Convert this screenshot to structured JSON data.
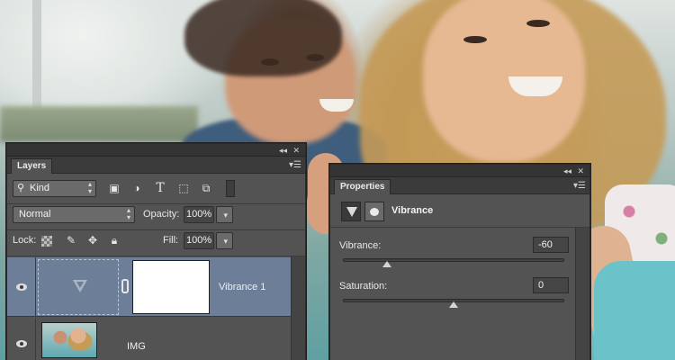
{
  "layers_panel": {
    "tab_label": "Layers",
    "filter": {
      "label": "Kind"
    },
    "blend_mode": "Normal",
    "opacity_label": "Opacity:",
    "opacity_value": "100%",
    "lock_label": "Lock:",
    "fill_label": "Fill:",
    "fill_value": "100%",
    "layers": [
      {
        "name": "Vibrance 1",
        "selected": true,
        "visible": true
      },
      {
        "name": "IMG",
        "selected": false,
        "visible": true
      }
    ]
  },
  "properties_panel": {
    "tab_label": "Properties",
    "adjustment_title": "Vibrance",
    "vibrance": {
      "label": "Vibrance:",
      "value": "-60",
      "fraction": 0.2
    },
    "saturation": {
      "label": "Saturation:",
      "value": "0",
      "fraction": 0.5
    }
  },
  "icons": {
    "panel_collapse": "double-chevron-left",
    "panel_close": "x",
    "panel_menu": "hamburger-menu",
    "filter_search": "magnifier",
    "filter_pixel": "image",
    "filter_adjustment": "half-circle",
    "filter_type": "T",
    "filter_shape": "transform-box",
    "filter_smart": "smart-object",
    "lock_transparent": "checkerboard",
    "lock_paint": "brush",
    "lock_move": "move-arrows",
    "lock_all": "padlock"
  },
  "colors": {
    "panel_bg": "#535353",
    "selected_layer": "#6d7e98",
    "field_bg": "#6a6a6a"
  }
}
